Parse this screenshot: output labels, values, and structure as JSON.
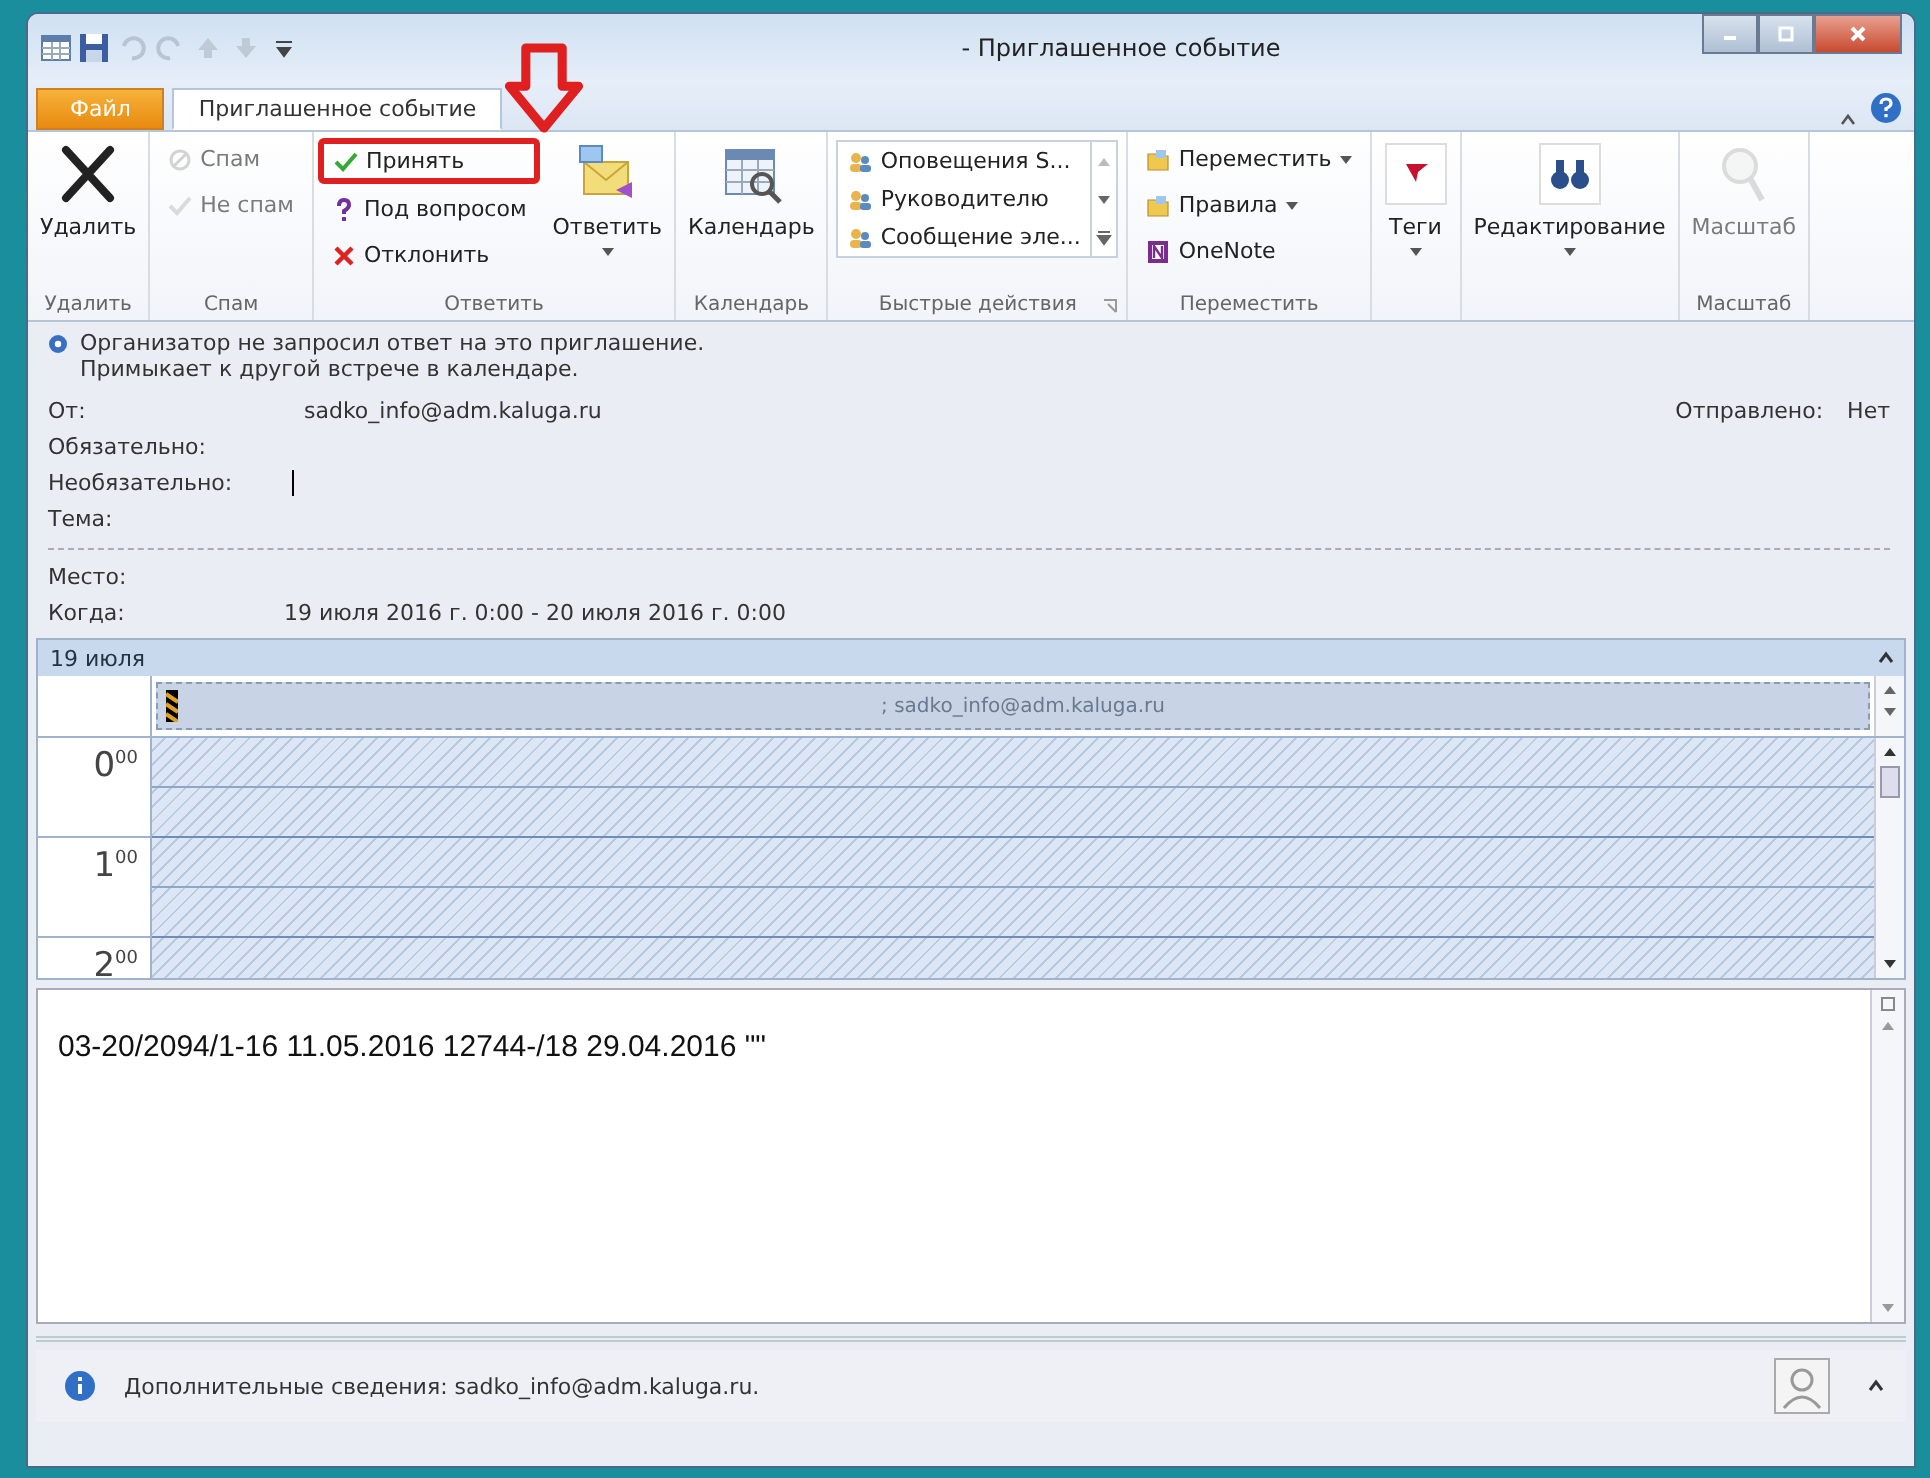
{
  "window": {
    "title": "- Приглашенное событие"
  },
  "tabs": [
    {
      "label": "Файл",
      "kind": "file",
      "selected": false
    },
    {
      "label": "Приглашенное событие",
      "kind": "tab",
      "selected": true
    }
  ],
  "ribbon": {
    "groups": [
      {
        "label": "Удалить",
        "items": [
          {
            "kind": "large",
            "label": "Удалить"
          }
        ]
      },
      {
        "label": "Спам",
        "items": [
          {
            "kind": "small",
            "label": "Спам",
            "disabled": true
          },
          {
            "kind": "small",
            "label": "Не спам",
            "disabled": true
          }
        ]
      },
      {
        "label": "Ответить",
        "items": [
          {
            "kind": "small",
            "label": "Принять",
            "highlighted": true
          },
          {
            "kind": "small",
            "label": "Под вопросом",
            "highlighted": false
          },
          {
            "kind": "small",
            "label": "Отклонить",
            "highlighted": false
          },
          {
            "kind": "large",
            "label": "Ответить",
            "dropdown": true
          }
        ]
      },
      {
        "label": "Календарь",
        "items": [
          {
            "kind": "large",
            "label": "Календарь"
          }
        ]
      },
      {
        "label": "Быстрые действия",
        "items": [
          {
            "kind": "gallery",
            "label": "Оповещения S..."
          },
          {
            "kind": "gallery",
            "label": "Руководителю"
          },
          {
            "kind": "gallery",
            "label": "Сообщение эле..."
          }
        ]
      },
      {
        "label": "Переместить",
        "items": [
          {
            "kind": "small",
            "label": "Переместить",
            "dropdown": true
          },
          {
            "kind": "small",
            "label": "Правила",
            "dropdown": true
          },
          {
            "kind": "small",
            "label": "OneNote",
            "dropdown": false
          }
        ]
      },
      {
        "items": [
          {
            "kind": "large",
            "label": "Теги",
            "dropdown": true
          }
        ]
      },
      {
        "items": [
          {
            "kind": "large",
            "label": "Редактирование",
            "dropdown": true
          }
        ]
      },
      {
        "label": "Масштаб",
        "items": [
          {
            "kind": "large",
            "label": "Масштаб",
            "disabled": true
          }
        ]
      }
    ]
  },
  "info": {
    "lines": [
      "Организатор не запросил ответ на это приглашение.",
      "Примыкает к другой встрече в календаре."
    ]
  },
  "fields": [
    {
      "label": "От:",
      "value": "sadko_info@adm.kaluga.ru"
    },
    {
      "label": "Обязательно:"
    },
    {
      "label": "Необязательно:",
      "focused": true
    },
    {
      "label": "Тема:"
    }
  ],
  "sent": {
    "label": "Отправлено:",
    "value": "Нет"
  },
  "details": [
    {
      "label": "Место:"
    },
    {
      "label": "Когда:",
      "value": "19 июля 2016 г. 0:00 - 20 июля 2016 г. 0:00"
    }
  ],
  "calendar": {
    "date": "19 июля",
    "event": "; sadko_info@adm.kaluga.ru",
    "hours": [
      {
        "hour": "0",
        "minutes": "00"
      },
      {
        "hour": "1",
        "minutes": "00"
      },
      {
        "hour": "2",
        "minutes": "00"
      }
    ]
  },
  "body": "03-20/2094/1-16 11.05.2016 12744-/18 29.04.2016 \"\"",
  "status": "Дополнительные сведения: sadko_info@adm.kaluga.ru."
}
